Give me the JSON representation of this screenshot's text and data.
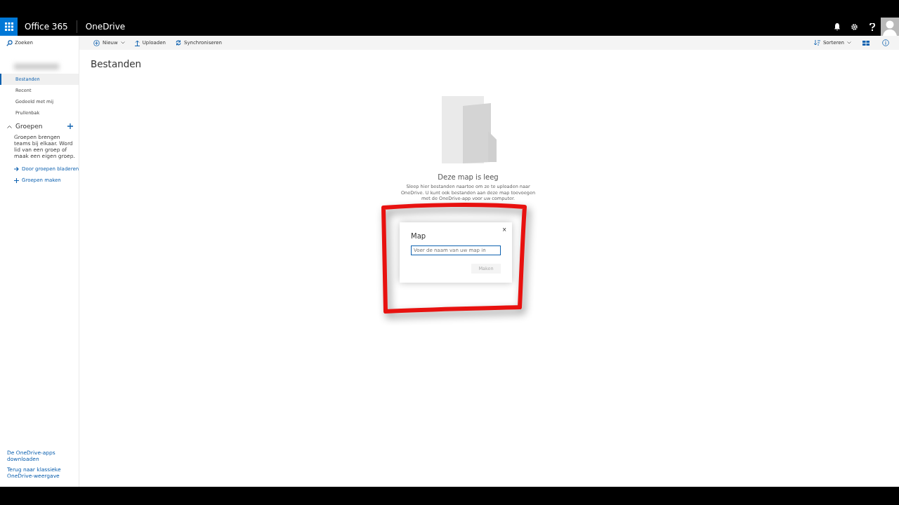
{
  "topbar": {
    "suite": "Office 365",
    "app": "OneDrive"
  },
  "sidebar": {
    "search": "Zoeken",
    "items": [
      {
        "label": "Bestanden",
        "selected": true
      },
      {
        "label": "Recent",
        "selected": false
      },
      {
        "label": "Gedeeld met mij",
        "selected": false
      },
      {
        "label": "Prullenbak",
        "selected": false
      }
    ],
    "groups": {
      "title": "Groepen",
      "expanded": true,
      "text": "Groepen brengen teams bij elkaar. Word lid van een groep of maak een eigen groep.",
      "links": [
        {
          "kind": "browse",
          "label": "Door groepen bladeren"
        },
        {
          "kind": "create",
          "label": "Groepen maken"
        }
      ]
    },
    "footer_links": [
      "De OneDrive-apps downloaden",
      "Terug naar klassieke OneDrive-weergave"
    ]
  },
  "commands": [
    {
      "kind": "new",
      "label": "Nieuw"
    },
    {
      "kind": "upload",
      "label": "Uploaden"
    },
    {
      "kind": "sync",
      "label": "Synchroniseren"
    }
  ],
  "sort": "Sorteren",
  "title": "Bestanden",
  "empty": {
    "title": "Deze map is leeg",
    "text": "Sleep hier bestanden naartoe om ze te uploaden naar OneDrive. U kunt ook bestanden aan deze map toevoegen met de OneDrive-app voor uw computer."
  },
  "dialog": {
    "title": "Map",
    "close": "×",
    "placeholder": "Voer de naam van uw map in",
    "button": "Maken",
    "button_disabled": true
  }
}
